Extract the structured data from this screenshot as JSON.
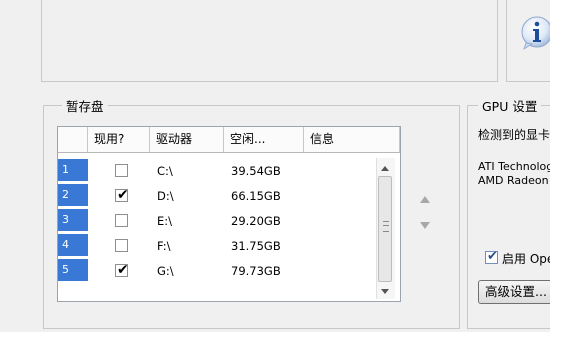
{
  "scratch_disks": {
    "group_title": "暂存盘",
    "columns": [
      "现用?",
      "驱动器",
      "空闲...",
      "信息"
    ],
    "rows": [
      {
        "num": "1",
        "active": false,
        "drive": "C:\\",
        "free": "39.54GB",
        "info": ""
      },
      {
        "num": "2",
        "active": true,
        "drive": "D:\\",
        "free": "66.15GB",
        "info": ""
      },
      {
        "num": "3",
        "active": false,
        "drive": "E:\\",
        "free": "29.20GB",
        "info": ""
      },
      {
        "num": "4",
        "active": false,
        "drive": "F:\\",
        "free": "31.75GB",
        "info": ""
      },
      {
        "num": "5",
        "active": true,
        "drive": "G:\\",
        "free": "79.73GB",
        "info": ""
      }
    ]
  },
  "gpu": {
    "group_title": "GPU 设置",
    "detected_label": "检测到的显卡",
    "card_line1": "ATI Technologies Inc.",
    "card_line2": "AMD Radeon",
    "enable_label": "启用 OpenGL",
    "enable_checked": true,
    "advanced_button": "高级设置..."
  },
  "icons": {
    "info": "info-icon",
    "move_up": "triangle-up-icon",
    "move_down": "triangle-down-icon"
  },
  "colors": {
    "row_number_bg": "#3a78d6",
    "dialog_bg": "#f0f0f0"
  }
}
